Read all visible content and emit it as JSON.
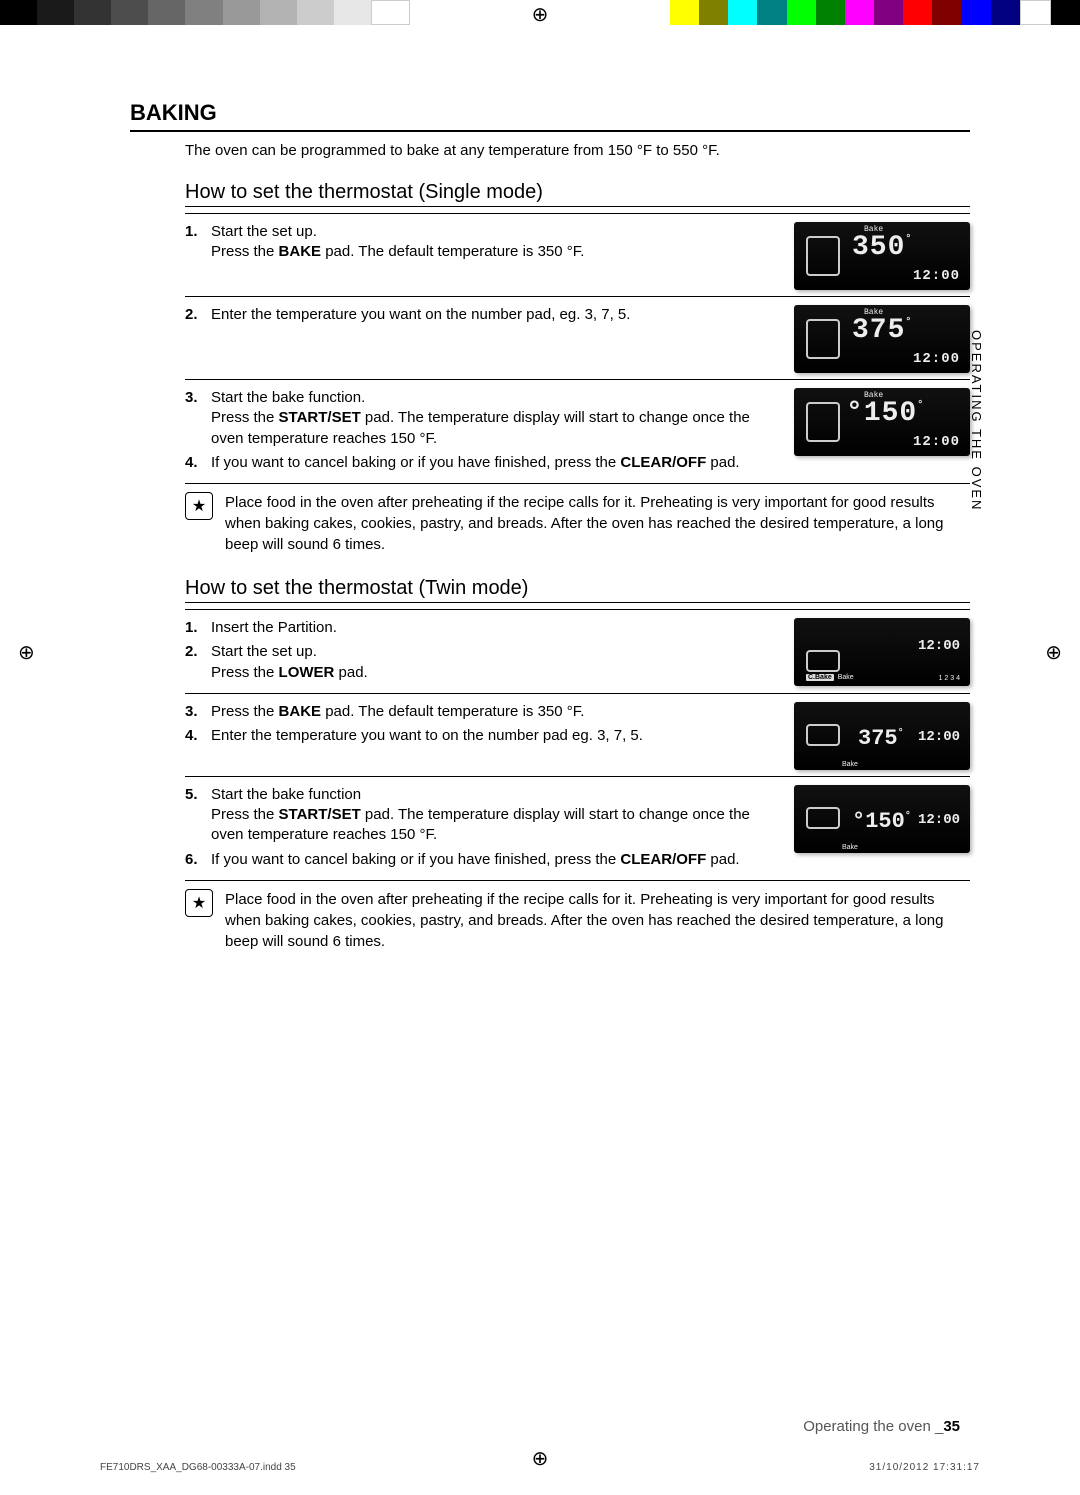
{
  "section_title": "BAKING",
  "intro": "The oven can be programmed to bake at any temperature from 150 °F to 550 °F.",
  "subhead_single": "How to set the thermostat (Single mode)",
  "single": {
    "step1_title": "Start the set up.",
    "step1_detail_a": "Press the ",
    "step1_detail_bold": "BAKE",
    "step1_detail_b": " pad. The default temperature is 350 °F.",
    "step2": "Enter the temperature you want on the number pad, eg. 3, 7, 5.",
    "step3_title": "Start the bake function.",
    "step3_detail_a": "Press the ",
    "step3_detail_bold": "START/SET",
    "step3_detail_b": " pad. The temperature display will start to change once the oven temperature reaches 150 °F.",
    "step4_a": "If you want to cancel baking or if you have finished, press the ",
    "step4_bold": "CLEAR/OFF",
    "step4_b": " pad."
  },
  "note": "Place food in the oven after preheating if the recipe calls for it. Preheating is very important for good results when baking cakes, cookies, pastry, and breads. After the oven has reached the desired temperature, a long beep will sound 6 times.",
  "subhead_twin": "How to set the thermostat (Twin mode)",
  "twin": {
    "step1": "Insert the Partition.",
    "step2_title": "Start the set up.",
    "step2_detail_a": "Press the ",
    "step2_detail_bold": "LOWER",
    "step2_detail_b": " pad.",
    "step3_a": "Press the ",
    "step3_bold": "BAKE",
    "step3_b": " pad. The default temperature is 350 °F.",
    "step4": "Enter the temperature you want to on the number pad eg. 3, 7, 5.",
    "step5_title": "Start the bake function",
    "step5_detail_a": "Press the ",
    "step5_detail_bold": "START/SET",
    "step5_detail_b": " pad. The temperature display will start to change once the oven temperature reaches 150 °F.",
    "step6_a": "If you want to cancel baking or if you have finished, press the ",
    "step6_bold": "CLEAR/OFF",
    "step6_b": " pad."
  },
  "display_label_bake": "Bake",
  "display_label_cbake": "C.Bake",
  "display_label_indicator": "1 2 3 4",
  "display_temp_350": "350",
  "display_temp_375": "375",
  "display_temp_150": "150",
  "display_clock": "12:00",
  "side_tab": "OPERATING THE OVEN",
  "footer_text": "Operating the oven _",
  "footer_page": "35",
  "footer_file": "FE710DRS_XAA_DG68-00333A-07.indd   35",
  "footer_timestamp": "31/10/2012   17:31:17",
  "nums": {
    "n1": "1.",
    "n2": "2.",
    "n3": "3.",
    "n4": "4.",
    "n5": "5.",
    "n6": "6."
  }
}
